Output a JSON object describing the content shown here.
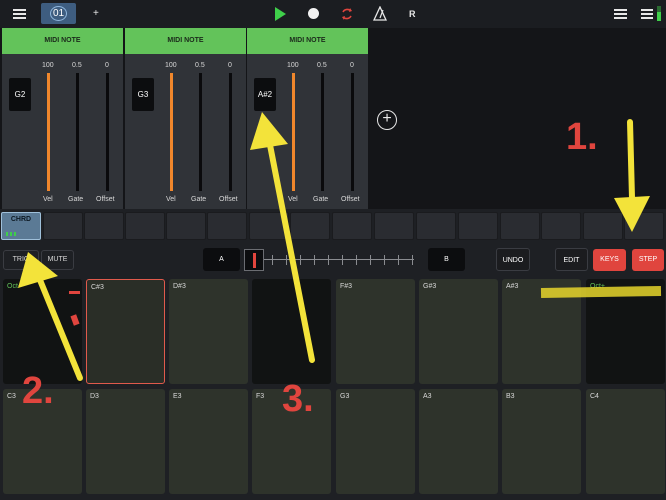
{
  "toolbar": {
    "sequence_tab": "01",
    "add_label": "+",
    "r_label": "R"
  },
  "modules": [
    {
      "title": "MIDI NOTE",
      "note": "G2",
      "scale_max": "100",
      "scale_mid": "0.5",
      "scale_zero": "0",
      "labels": {
        "vel": "Vel",
        "gate": "Gate",
        "offset": "Offset"
      }
    },
    {
      "title": "MIDI NOTE",
      "note": "G3",
      "scale_max": "100",
      "scale_mid": "0.5",
      "scale_zero": "0",
      "labels": {
        "vel": "Vel",
        "gate": "Gate",
        "offset": "Offset"
      }
    },
    {
      "title": "MIDI NOTE",
      "note": "A#2",
      "scale_max": "100",
      "scale_mid": "0.5",
      "scale_zero": "0",
      "labels": {
        "vel": "Vel",
        "gate": "Gate",
        "offset": "Offset"
      }
    }
  ],
  "add_module": "+",
  "pattern_slot_active": "CHRD",
  "controls": {
    "trig": "TRIG",
    "mute": "MUTE",
    "a": "A",
    "b": "B",
    "undo": "UNDO",
    "edit": "EDIT",
    "keys": "KEYS",
    "step": "STEP"
  },
  "pads_top": [
    "Oct-",
    "C#3",
    "D#3",
    "",
    "F#3",
    "G#3",
    "A#3",
    "Oct+"
  ],
  "pads_bottom": [
    "C3",
    "D3",
    "E3",
    "F3",
    "G3",
    "A3",
    "B3",
    "C4"
  ],
  "annotations": {
    "one": "1.",
    "two": "2.",
    "three": "3."
  },
  "colors": {
    "accent_green": "#63c35a",
    "slider_orange": "#f0872c",
    "keys_red": "#e0453e",
    "annotation_yellow": "#f3e33a"
  }
}
